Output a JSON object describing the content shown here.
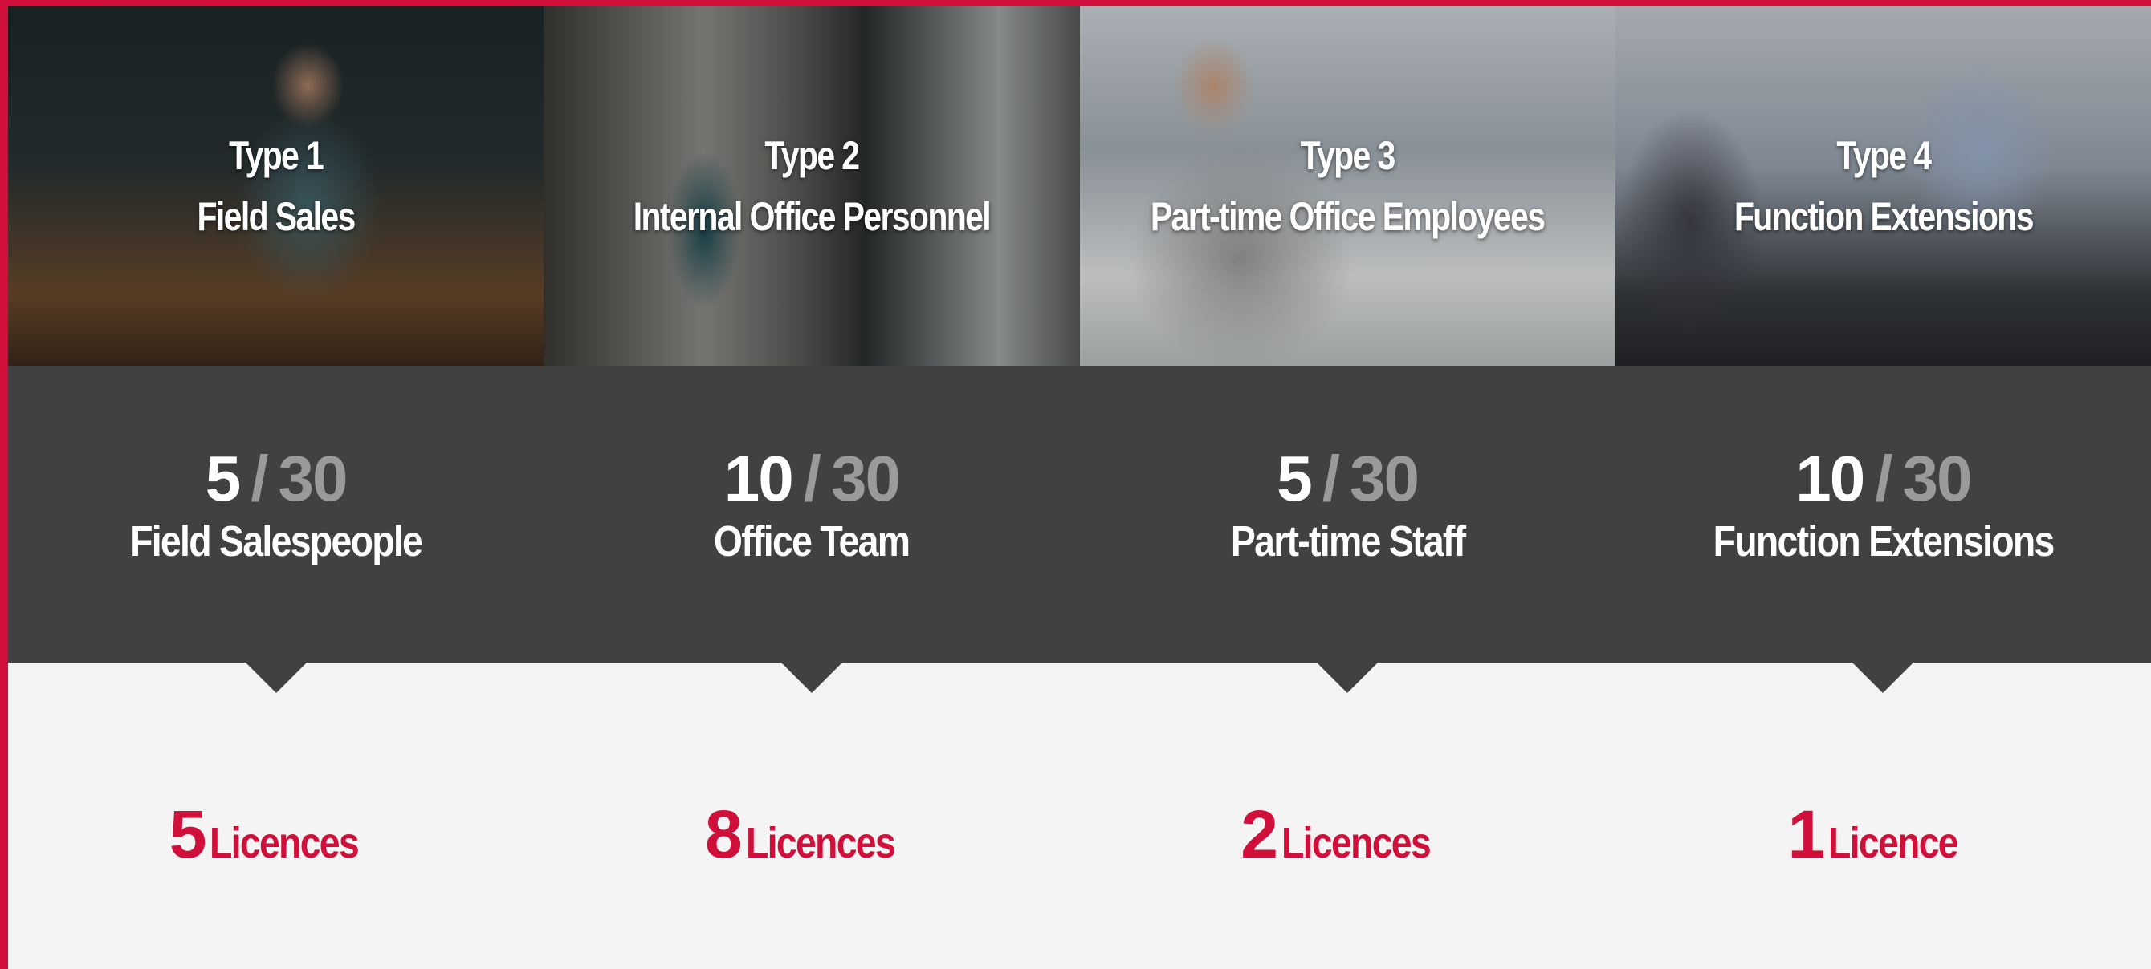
{
  "colors": {
    "accent": "#d0103a",
    "panel": "#414141",
    "muted": "#9a9a9a",
    "background": "#f4f4f4"
  },
  "types": [
    {
      "type_label": "Type 1",
      "title": "Field Sales",
      "current": "5",
      "max": "30",
      "stat_label": "Field Salespeople",
      "licence_count": "5",
      "licence_word": "Licences"
    },
    {
      "type_label": "Type 2",
      "title": "Internal Office Personnel",
      "current": "10",
      "max": "30",
      "stat_label": "Office Team",
      "licence_count": "8",
      "licence_word": "Licences"
    },
    {
      "type_label": "Type 3",
      "title": "Part-time Office Employees",
      "current": "5",
      "max": "30",
      "stat_label": "Part-time Staff",
      "licence_count": "2",
      "licence_word": "Licences"
    },
    {
      "type_label": "Type 4",
      "title": "Function Extensions",
      "current": "10",
      "max": "30",
      "stat_label": "Function Extensions",
      "licence_count": "1",
      "licence_word": "Licence"
    }
  ],
  "separator": "/"
}
